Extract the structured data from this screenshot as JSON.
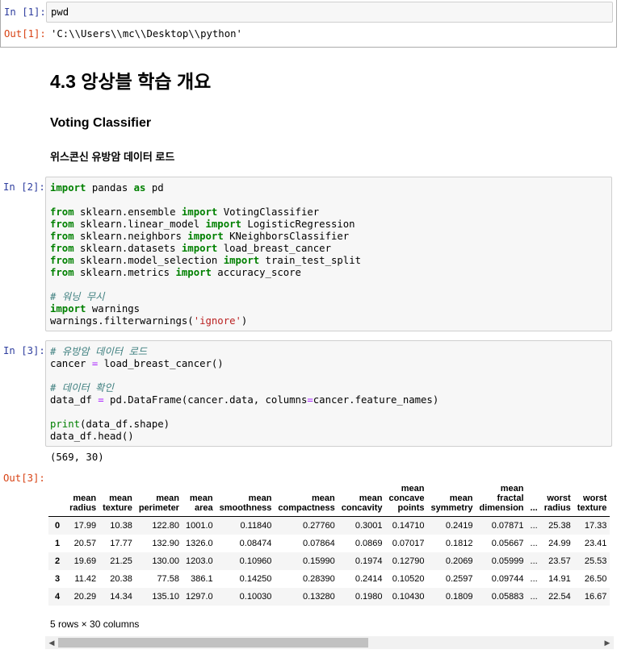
{
  "cell1": {
    "in_prompt": "In [1]:",
    "code": "pwd",
    "out_prompt": "Out[1]:",
    "output": "'C:\\\\Users\\\\mc\\\\Desktop\\\\python'"
  },
  "heading": "4.3 앙상블 학습 개요",
  "subheading": "Voting Classifier",
  "subsubheading": "위스콘신 유방암 데이터 로드",
  "cell2": {
    "in_prompt": "In [2]:",
    "lines": [
      "import pandas as pd",
      "",
      "from sklearn.ensemble import VotingClassifier",
      "from sklearn.linear_model import LogisticRegression",
      "from sklearn.neighbors import KNeighborsClassifier",
      "from sklearn.datasets import load_breast_cancer",
      "from sklearn.model_selection import train_test_split",
      "from sklearn.metrics import accuracy_score",
      "",
      "# 워닝 무시",
      "import warnings",
      "warnings.filterwarnings('ignore')"
    ]
  },
  "cell3": {
    "in_prompt": "In [3]:",
    "lines": [
      "# 유방암 데이터 로드",
      "cancer = load_breast_cancer()",
      "",
      "# 데이터 확인",
      "data_df = pd.DataFrame(cancer.data, columns=cancer.feature_names)",
      "",
      "print(data_df.shape)",
      "data_df.head()"
    ],
    "stdout": "(569, 30)",
    "out_prompt": "Out[3]:"
  },
  "dataframe": {
    "columns": [
      [
        "mean",
        "radius"
      ],
      [
        "mean",
        "texture"
      ],
      [
        "mean",
        "perimeter"
      ],
      [
        "mean",
        "area"
      ],
      [
        "mean",
        "smoothness"
      ],
      [
        "mean",
        "compactness"
      ],
      [
        "mean",
        "concavity"
      ],
      [
        "mean",
        "concave",
        "points"
      ],
      [
        "mean",
        "symmetry"
      ],
      [
        "mean",
        "fractal",
        "dimension"
      ],
      [
        "..."
      ],
      [
        "worst",
        "radius"
      ],
      [
        "worst",
        "texture"
      ]
    ],
    "rows": [
      {
        "index": "0",
        "values": [
          "17.99",
          "10.38",
          "122.80",
          "1001.0",
          "0.11840",
          "0.27760",
          "0.3001",
          "0.14710",
          "0.2419",
          "0.07871",
          "...",
          "25.38",
          "17.33"
        ]
      },
      {
        "index": "1",
        "values": [
          "20.57",
          "17.77",
          "132.90",
          "1326.0",
          "0.08474",
          "0.07864",
          "0.0869",
          "0.07017",
          "0.1812",
          "0.05667",
          "...",
          "24.99",
          "23.41"
        ]
      },
      {
        "index": "2",
        "values": [
          "19.69",
          "21.25",
          "130.00",
          "1203.0",
          "0.10960",
          "0.15990",
          "0.1974",
          "0.12790",
          "0.2069",
          "0.05999",
          "...",
          "23.57",
          "25.53"
        ]
      },
      {
        "index": "3",
        "values": [
          "11.42",
          "20.38",
          "77.58",
          "386.1",
          "0.14250",
          "0.28390",
          "0.2414",
          "0.10520",
          "0.2597",
          "0.09744",
          "...",
          "14.91",
          "26.50"
        ]
      },
      {
        "index": "4",
        "values": [
          "20.29",
          "14.34",
          "135.10",
          "1297.0",
          "0.10030",
          "0.13280",
          "0.1980",
          "0.10430",
          "0.1809",
          "0.05883",
          "...",
          "22.54",
          "16.67"
        ]
      }
    ],
    "footer": "5 rows × 30 columns",
    "scroll_fraction": 0.55
  },
  "colors": {
    "in_prompt": "#303f9f",
    "out_prompt": "#d84315",
    "keyword": "#008000",
    "comment": "#408080",
    "string": "#ba2121"
  }
}
